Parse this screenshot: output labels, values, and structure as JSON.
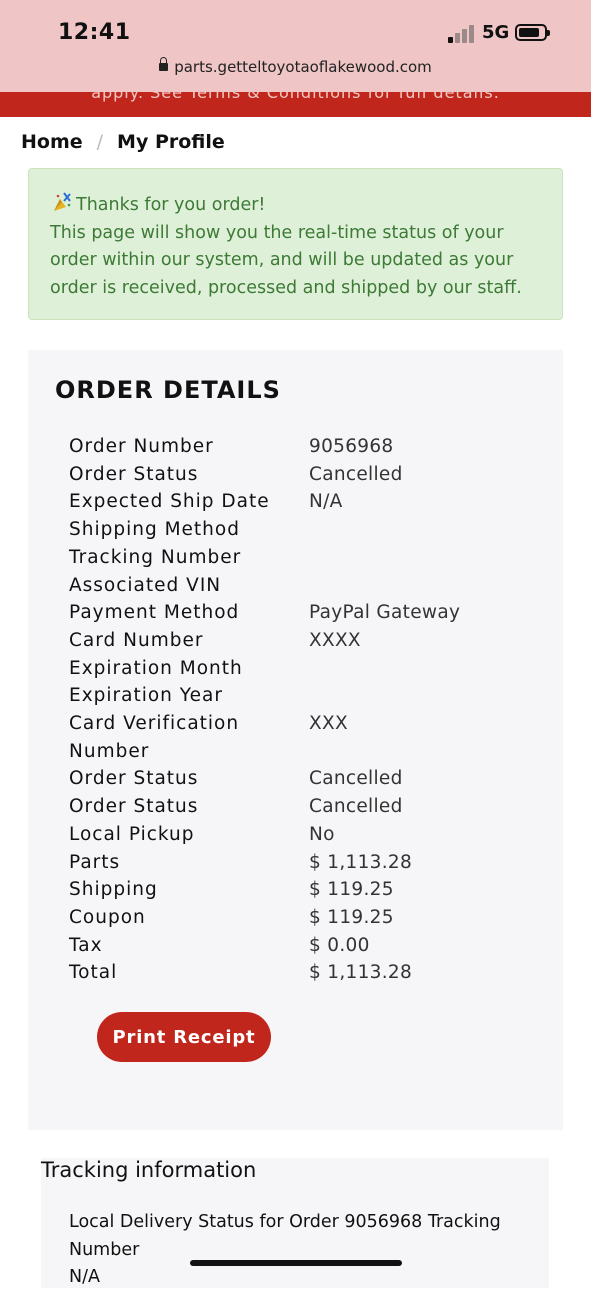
{
  "status_bar": {
    "time": "12:41",
    "network": "5G"
  },
  "browser": {
    "url": "parts.getteltoyotaoflakewood.com"
  },
  "promo_text": "apply. See Terms & Conditions for full details.",
  "breadcrumb": {
    "home": "Home",
    "separator": "/",
    "current": "My Profile"
  },
  "alert": {
    "title": "Thanks for you order!",
    "body": "This page will show you the real-time status of your order within our system, and will be updated as your order is received, processed and shipped by our staff."
  },
  "order": {
    "heading": "ORDER DETAILS",
    "rows": [
      {
        "label": "Order Number",
        "value": "9056968"
      },
      {
        "label": "Order Status",
        "value": "Cancelled"
      },
      {
        "label": "Expected Ship Date",
        "value": "N/A"
      },
      {
        "label": "Shipping Method",
        "value": ""
      },
      {
        "label": "Tracking Number",
        "value": ""
      },
      {
        "label": "Associated VIN",
        "value": ""
      },
      {
        "label": "Payment Method",
        "value": "PayPal Gateway"
      },
      {
        "label": "Card Number",
        "value": "XXXX"
      },
      {
        "label": "Expiration Month",
        "value": ""
      },
      {
        "label": "Expiration Year",
        "value": ""
      },
      {
        "label": "Card Verification Number",
        "value": "XXX"
      },
      {
        "label": "Order Status",
        "value": "Cancelled"
      },
      {
        "label": "Order Status",
        "value": "Cancelled"
      },
      {
        "label": "Local Pickup",
        "value": "No"
      },
      {
        "label": "Parts",
        "value": "$ 1,113.28"
      },
      {
        "label": "Shipping",
        "value": "$ 119.25"
      },
      {
        "label": "Coupon",
        "value": "$ 119.25"
      },
      {
        "label": "Tax",
        "value": "$ 0.00"
      },
      {
        "label": "Total",
        "value": "$ 1,113.28"
      }
    ],
    "print_label": "Print Receipt"
  },
  "tracking": {
    "heading": "Tracking information",
    "text": "Local Delivery Status for Order 9056968 Tracking Number",
    "value": "N/A"
  },
  "colors": {
    "brand_red": "#c1261c",
    "alert_bg": "#dff0d8",
    "alert_text": "#3c7a36",
    "card_bg": "#f6f6f8"
  }
}
